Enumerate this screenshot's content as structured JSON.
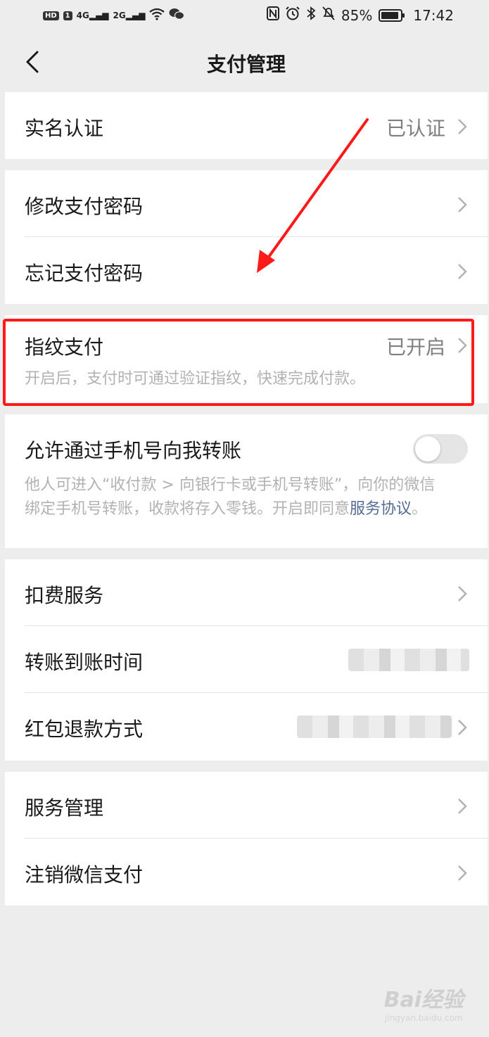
{
  "status_bar": {
    "left_badges": [
      "HD",
      "1"
    ],
    "signal_1": "4G",
    "signal_2": "2G",
    "battery": "85%",
    "time": "17:42",
    "icons": [
      "nfc-icon",
      "alarm-icon",
      "bluetooth-icon",
      "mute-icon"
    ]
  },
  "nav": {
    "title": "支付管理"
  },
  "sections": {
    "realname": {
      "label": "实名认证",
      "value": "已认证"
    },
    "password": {
      "modify": "修改支付密码",
      "forgot": "忘记支付密码"
    },
    "fingerprint": {
      "label": "指纹支付",
      "value": "已开启",
      "desc": "开启后，支付时可通过验证指纹，快速完成付款。"
    },
    "phone_transfer": {
      "label": "允许通过手机号向我转账",
      "toggle_on": false,
      "desc_line1": "他人可进入“收付款 > 向银行卡或手机号转账”，向你的微信",
      "desc_line2": "绑定手机号转账，收款将存入零钱。开启即同意",
      "link": "服务协议",
      "desc_end": "。"
    },
    "services": {
      "deduct": "扣费服务",
      "transfer_time": "转账到账时间",
      "redpacket_refund": "红包退款方式"
    },
    "manage": {
      "service_manage": "服务管理",
      "cancel_pay": "注销微信支付"
    }
  },
  "colors": {
    "annotation": "#ff1a1a",
    "link": "#576b95",
    "background": "#ededed"
  },
  "watermark": {
    "brand": "Bai经验",
    "url": "jingyan.baidu.com"
  }
}
